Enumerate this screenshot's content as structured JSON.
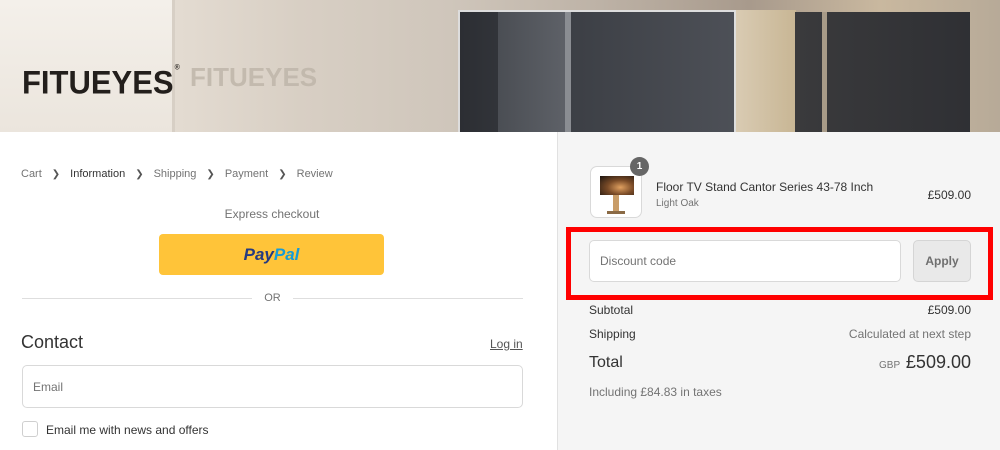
{
  "brand": {
    "logo_text": "FITUEYES",
    "trademark": "®",
    "ghost_logo": "FITUEYES"
  },
  "breadcrumb": {
    "items": [
      "Cart",
      "Information",
      "Shipping",
      "Payment",
      "Review"
    ],
    "active_index": 1
  },
  "express_checkout": {
    "label": "Express checkout",
    "paypal_part1": "Pay",
    "paypal_part2": "Pal",
    "divider_text": "OR"
  },
  "contact": {
    "title": "Contact",
    "login_label": "Log in",
    "email_placeholder": "Email",
    "newsletter_label": "Email me with news and offers",
    "newsletter_checked": false
  },
  "order_summary": {
    "product": {
      "name": "Floor TV Stand Cantor Series 43-78 Inch",
      "variant": "Light Oak",
      "price": "£509.00",
      "quantity": "1"
    },
    "discount": {
      "placeholder": "Discount code",
      "apply_label": "Apply"
    },
    "subtotal_label": "Subtotal",
    "subtotal_value": "£509.00",
    "shipping_label": "Shipping",
    "shipping_value": "Calculated at next step",
    "total_label": "Total",
    "total_currency": "GBP",
    "total_value": "£509.00",
    "tax_note": "Including £84.83 in taxes"
  },
  "colors": {
    "paypal_yellow": "#ffc439",
    "highlight_red": "#ff0000",
    "summary_bg": "#f5f5f5"
  }
}
